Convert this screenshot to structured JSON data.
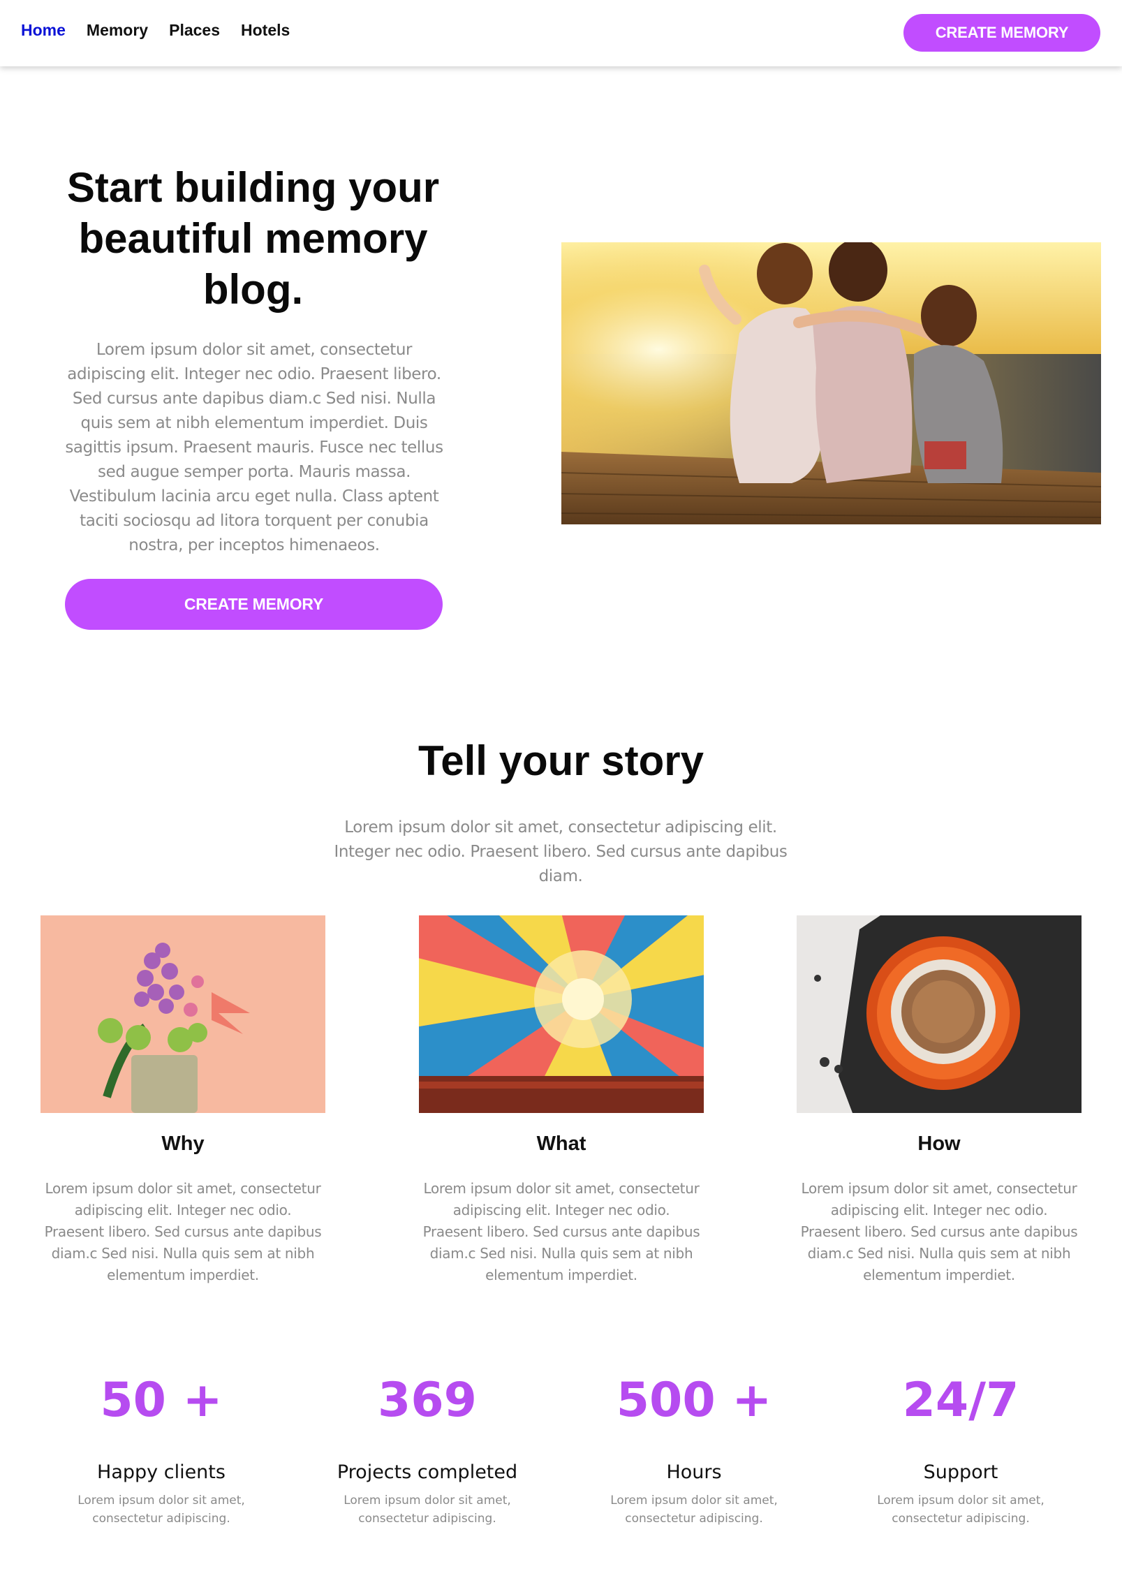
{
  "nav": {
    "links": [
      {
        "label": "Home",
        "active": true
      },
      {
        "label": "Memory",
        "active": false
      },
      {
        "label": "Places",
        "active": false
      },
      {
        "label": "Hotels",
        "active": false
      }
    ],
    "cta_label": "CREATE MEMORY"
  },
  "hero": {
    "title": "Start building your beautiful memory blog.",
    "text": "Lorem ipsum dolor sit amet, consectetur adipiscing elit. Integer nec odio. Praesent libero. Sed cursus ante dapibus diam.c Sed nisi. Nulla quis sem at nibh elementum imperdiet. Duis sagittis ipsum. Praesent mauris. Fusce nec tellus sed augue semper porta. Mauris massa. Vestibulum lacinia arcu eget nulla. Class aptent taciti sociosqu ad litora torquent per conubia nostra, per inceptos himenaeos.",
    "cta_label": "CREATE MEMORY",
    "image": "children-sitting-on-pier-at-sunset"
  },
  "story": {
    "title": "Tell your story",
    "text": "Lorem ipsum dolor sit amet, consectetur adipiscing elit. Integer nec odio. Praesent libero. Sed cursus ante dapibus diam.",
    "cards": [
      {
        "title": "Why",
        "image": "flowers-in-vase",
        "text": "Lorem ipsum dolor sit amet, consectetur adipiscing elit. Integer nec odio. Praesent libero. Sed cursus ante dapibus diam.c Sed nisi. Nulla quis sem at nibh elementum imperdiet."
      },
      {
        "title": "What",
        "image": "hot-air-balloon-interior",
        "text": "Lorem ipsum dolor sit amet, consectetur adipiscing elit. Integer nec odio. Praesent libero. Sed cursus ante dapibus diam.c Sed nisi. Nulla quis sem at nibh elementum imperdiet."
      },
      {
        "title": "How",
        "image": "coffee-cup-top-view",
        "text": "Lorem ipsum dolor sit amet, consectetur adipiscing elit. Integer nec odio. Praesent libero. Sed cursus ante dapibus diam.c Sed nisi. Nulla quis sem at nibh elementum imperdiet."
      }
    ]
  },
  "stats": [
    {
      "value": "50 +",
      "label": "Happy clients",
      "desc": "Lorem ipsum dolor sit amet, consectetur adipiscing."
    },
    {
      "value": "369",
      "label": "Projects completed",
      "desc": "Lorem ipsum dolor sit amet, consectetur adipiscing."
    },
    {
      "value": "500 +",
      "label": "Hours",
      "desc": "Lorem ipsum dolor sit amet, consectetur adipiscing."
    },
    {
      "value": "24/7",
      "label": "Support",
      "desc": "Lorem ipsum dolor sit amet, consectetur adipiscing."
    }
  ],
  "colors": {
    "accent": "#c14dff",
    "stat": "#b64cf0",
    "nav_active": "#0b12d6",
    "body_text": "#8a8a8a"
  }
}
